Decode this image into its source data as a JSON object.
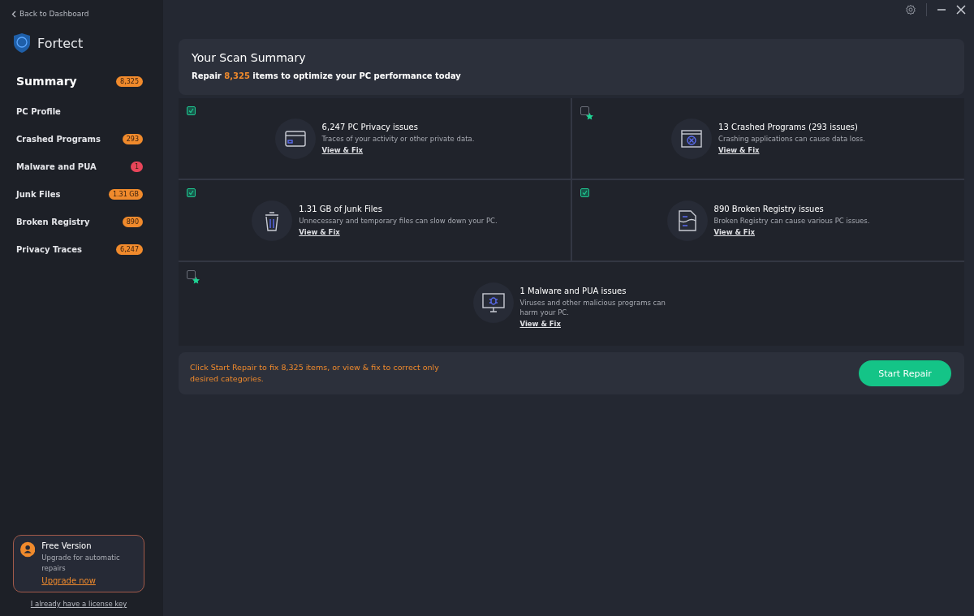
{
  "sidebar": {
    "back": "Back to Dashboard",
    "brand": "Fortect",
    "items": [
      {
        "label": "Summary",
        "badge": "8,325",
        "color": "#f08a2c",
        "selected": true
      },
      {
        "label": "PC Profile",
        "selected": false
      },
      {
        "label": "Crashed Programs",
        "badge": "293",
        "color": "#f08a2c",
        "selected": false
      },
      {
        "label": "Malware and PUA",
        "badge": "1",
        "color": "#e8455a",
        "selected": false
      },
      {
        "label": "Junk Files",
        "badge": "1.31 GB",
        "color": "#f08a2c",
        "selected": false
      },
      {
        "label": "Broken Registry",
        "badge": "890",
        "color": "#f08a2c",
        "selected": false
      },
      {
        "label": "Privacy Traces",
        "badge": "6,247",
        "color": "#f08a2c",
        "selected": false
      }
    ],
    "promo": {
      "title": "Free Version",
      "text": "Upgrade for automatic repairs",
      "link": "Upgrade now"
    },
    "license_link": "I already have a license key"
  },
  "summary": {
    "title": "Your Scan Summary",
    "subtitle": "Repair **8,325** items to optimize your PC performance today"
  },
  "categories": [
    {
      "kind": "privacy",
      "title": "6,247 PC Privacy issues",
      "text": "Traces of your activity or other private data.",
      "link": "View & Fix",
      "checked": true,
      "premium": false
    },
    {
      "kind": "crash",
      "title": "13 Crashed Programs (293 issues)",
      "text": "Crashing applications can cause data loss.",
      "link": "View & Fix",
      "checked": false,
      "premium": true
    },
    {
      "kind": "junk",
      "title": "1.31 GB of Junk Files",
      "text": "Unnecessary and temporary files can slow down your PC.",
      "link": "View & Fix",
      "checked": true,
      "premium": false
    },
    {
      "kind": "registry",
      "title": "890 Broken Registry issues",
      "text": "Broken Registry can cause various PC issues.",
      "link": "View & Fix",
      "checked": true,
      "premium": false
    },
    {
      "kind": "malware",
      "title": "1 Malware and PUA issues",
      "text": "Viruses and other malicious programs can harm your PC.",
      "link": "View & Fix",
      "checked": false,
      "premium": true
    }
  ],
  "footer": {
    "note": "Click Start Repair to fix 8,325 items, or view & fix to correct only desired categories.",
    "button": "Start Repair"
  }
}
